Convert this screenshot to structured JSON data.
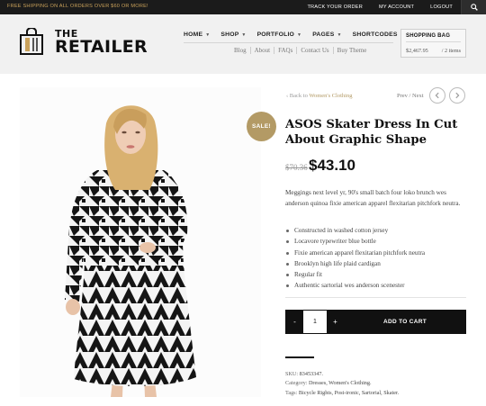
{
  "topbar": {
    "promo": "FREE SHIPPING ON ALL ORDERS OVER $60 OR MORE!",
    "links": [
      "TRACK YOUR ORDER",
      "MY ACCOUNT",
      "LOGOUT"
    ],
    "search_icon": "search-icon"
  },
  "logo": {
    "line1": "THE",
    "line2": "RETAILER",
    "icon": "shopping-bag-icon"
  },
  "nav": {
    "main": [
      "HOME",
      "SHOP",
      "PORTFOLIO",
      "PAGES",
      "SHORTCODES"
    ],
    "sub": [
      "Blog",
      "About",
      "FAQs",
      "Contact Us",
      "Buy Theme"
    ]
  },
  "bag": {
    "title": "SHOPPING BAG",
    "total": "$2,467.95",
    "items": "/ 2 items"
  },
  "product": {
    "sale_badge": "SALE!",
    "back_prefix": "‹ Back to ",
    "back_category": "Women's Clothing",
    "prev_next": "Prev / Next",
    "title": "ASOS Skater Dress In Cut About Graphic Shape",
    "old_price": "$70.36",
    "new_price": "$43.10",
    "description": "Meggings next level yr, 90's small batch four loko brunch wes anderson quinoa fixie american apparel flexitarian pitchfork neutra.",
    "features": [
      "Constructed in washed cotton jersey",
      "Locavore typewriter blue bottle",
      "Fixie american apparel flexitarian pitchfork neutra",
      "Brooklyn high life plaid cardigan",
      "Regular fit",
      "Authentic sartorial wes anderson scenester"
    ],
    "quantity": "1",
    "minus": "-",
    "plus": "+",
    "add_to_cart": "ADD TO CART",
    "sku_label": "SKU: ",
    "sku_value": "83453347.",
    "category_label": "Category: ",
    "category_value": "Dresses, Women's Clothing.",
    "tags_label": "Tags: ",
    "tags_value": "Bicycle Rights, Post-ironic, Sartorial, Skater."
  },
  "colors": {
    "accent": "#b39a65",
    "dark": "#111111",
    "topbar": "#1b1b1b",
    "header": "#f1f1f1"
  }
}
